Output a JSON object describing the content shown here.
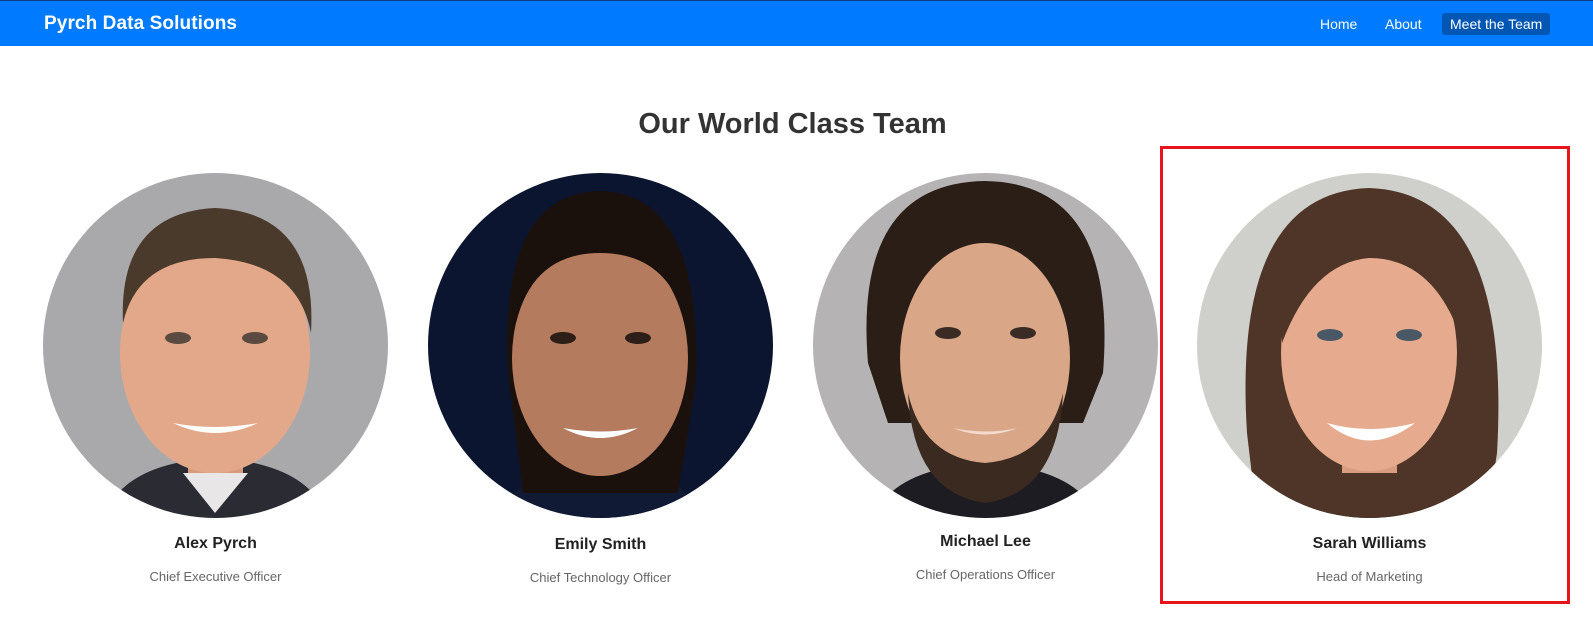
{
  "nav": {
    "brand": "Pyrch Data Solutions",
    "links": [
      {
        "label": "Home",
        "active": false
      },
      {
        "label": "About",
        "active": false
      },
      {
        "label": "Meet the Team",
        "active": true
      }
    ]
  },
  "page": {
    "title": "Our World Class Team"
  },
  "team": [
    {
      "name": "Alex Pyrch",
      "role": "Chief Executive Officer",
      "icon": "portrait-photo"
    },
    {
      "name": "Emily Smith",
      "role": "Chief Technology Officer",
      "icon": "portrait-photo"
    },
    {
      "name": "Michael Lee",
      "role": "Chief Operations Officer",
      "icon": "portrait-photo"
    },
    {
      "name": "Sarah Williams",
      "role": "Head of Marketing",
      "icon": "portrait-photo"
    }
  ],
  "colors": {
    "navbar": "#007bff",
    "active_link": "#0056b3",
    "highlight": "#e8141b"
  }
}
